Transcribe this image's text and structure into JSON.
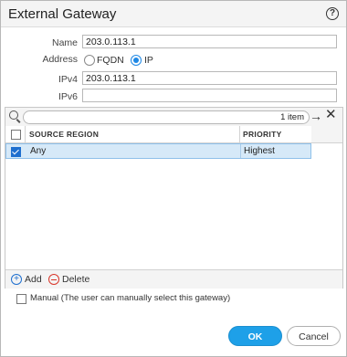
{
  "dialog": {
    "title": "External Gateway",
    "help_icon": "help-icon"
  },
  "form": {
    "name": {
      "label": "Name",
      "value": "203.0.113.1"
    },
    "address": {
      "label": "Address",
      "options": [
        {
          "label": "FQDN",
          "selected": false
        },
        {
          "label": "IP",
          "selected": true
        }
      ]
    },
    "ipv4": {
      "label": "IPv4",
      "value": "203.0.113.1"
    },
    "ipv6": {
      "label": "IPv6",
      "value": ""
    }
  },
  "grid": {
    "search": {
      "placeholder": "",
      "count_text": "1 item"
    },
    "columns": [
      "SOURCE REGION",
      "PRIORITY"
    ],
    "rows": [
      {
        "checked": true,
        "source_region": "Any",
        "priority": "Highest"
      }
    ],
    "actions": {
      "add_label": "Add",
      "delete_label": "Delete"
    }
  },
  "manual": {
    "label": "Manual (The user can manually select this gateway)",
    "checked": false
  },
  "buttons": {
    "ok": "OK",
    "cancel": "Cancel"
  },
  "colors": {
    "accent": "#1ea0e8",
    "selection": "#d6e9f8",
    "delete": "#d9362a"
  }
}
